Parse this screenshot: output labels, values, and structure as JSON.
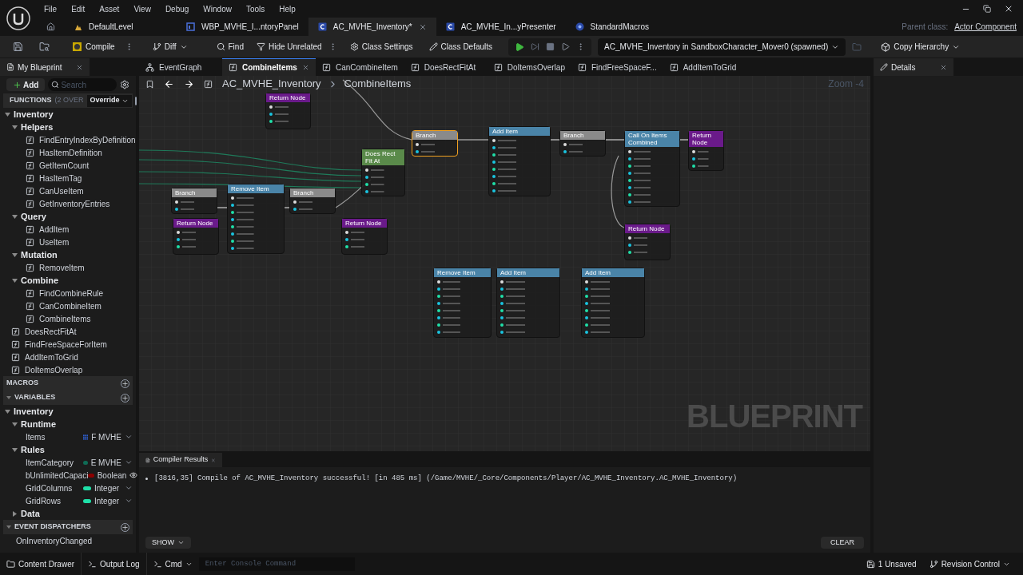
{
  "menu": [
    "File",
    "Edit",
    "Asset",
    "View",
    "Debug",
    "Window",
    "Tools",
    "Help"
  ],
  "asset_tabs": [
    {
      "label": "DefaultLevel",
      "kind": "level",
      "selected": false
    },
    {
      "label": "WBP_MVHE_I...ntoryPanel",
      "kind": "widget",
      "selected": false
    },
    {
      "label": "AC_MVHE_Inventory*",
      "kind": "blueprint",
      "selected": true
    },
    {
      "label": "AC_MVHE_In...yPresenter",
      "kind": "blueprint",
      "selected": false
    },
    {
      "label": "StandardMacros",
      "kind": "macro",
      "selected": false
    }
  ],
  "parent_class": {
    "label": "Parent class:",
    "value": "Actor Component"
  },
  "toolbar": {
    "compile": "Compile",
    "diff": "Diff",
    "find": "Find",
    "hide_unrelated": "Hide Unrelated",
    "class_settings": "Class Settings",
    "class_defaults": "Class Defaults",
    "debug_object": "AC_MVHE_Inventory in SandboxCharacter_Mover0 (spawned)",
    "copy_hierarchy": "Copy Hierarchy"
  },
  "my_blueprint": {
    "title": "My Blueprint",
    "add": "Add",
    "search": {
      "placeholder": "Search"
    },
    "functions": {
      "title": "FUNCTIONS",
      "note": "(2 OVER",
      "override": "Override",
      "items": [
        {
          "label": "Inventory",
          "kind": "category",
          "expanded": true,
          "children": [
            {
              "label": "Helpers",
              "kind": "category",
              "expanded": true,
              "children": [
                {
                  "label": "FindEntryIndexByDefinition",
                  "kind": "function"
                },
                {
                  "label": "HasItemDefinition",
                  "kind": "function"
                },
                {
                  "label": "GetItemCount",
                  "kind": "function"
                },
                {
                  "label": "HasItemTag",
                  "kind": "function"
                },
                {
                  "label": "CanUseItem",
                  "kind": "function"
                },
                {
                  "label": "GetInventoryEntries",
                  "kind": "function"
                }
              ]
            },
            {
              "label": "Query",
              "kind": "category",
              "expanded": true,
              "children": [
                {
                  "label": "AddItem",
                  "kind": "function"
                },
                {
                  "label": "UseItem",
                  "kind": "function"
                }
              ]
            },
            {
              "label": "Mutation",
              "kind": "category",
              "expanded": true,
              "children": [
                {
                  "label": "RemoveItem",
                  "kind": "function"
                }
              ]
            },
            {
              "label": "Combine",
              "kind": "category",
              "expanded": true,
              "children": [
                {
                  "label": "FindCombineRule",
                  "kind": "function"
                },
                {
                  "label": "CanCombineItem",
                  "kind": "function"
                },
                {
                  "label": "CombineItems",
                  "kind": "function"
                }
              ]
            }
          ]
        },
        {
          "label": "DoesRectFitAt",
          "kind": "function"
        },
        {
          "label": "FindFreeSpaceForItem",
          "kind": "function"
        },
        {
          "label": "AddItemToGrid",
          "kind": "function"
        },
        {
          "label": "DoItemsOverlap",
          "kind": "function"
        }
      ]
    },
    "macros": {
      "title": "MACROS"
    },
    "variables": {
      "title": "VARIABLES",
      "items": [
        {
          "label": "Inventory",
          "kind": "category",
          "expanded": true,
          "children": [
            {
              "label": "Runtime",
              "kind": "category",
              "expanded": true,
              "children": [
                {
                  "label": "Items",
                  "kind": "array-variable",
                  "type": "F MVHE",
                  "color": "#2f5fd0",
                  "instance_editable": false
                }
              ]
            },
            {
              "label": "Rules",
              "kind": "category",
              "expanded": true,
              "children": [
                {
                  "label": "ItemCategory",
                  "kind": "variable",
                  "type": "E MVHE",
                  "color": "#0f6b55",
                  "instance_editable": false
                },
                {
                  "label": "bUnlimitedCapaci",
                  "kind": "variable",
                  "type": "Boolean",
                  "color": "#8c0000",
                  "instance_editable": true
                },
                {
                  "label": "GridColumns",
                  "kind": "variable",
                  "type": "Integer",
                  "color": "#1fe0a8",
                  "instance_editable": false
                },
                {
                  "label": "GridRows",
                  "kind": "variable",
                  "type": "Integer",
                  "color": "#1fe0a8",
                  "instance_editable": false
                }
              ]
            },
            {
              "label": "Data",
              "kind": "category",
              "expanded": false
            }
          ]
        }
      ]
    },
    "event_dispatchers": {
      "title": "EVENT DISPATCHERS",
      "items": [
        "OnInventoryChanged"
      ]
    }
  },
  "graph_tabs": [
    {
      "label": "EventGraph",
      "kind": "graph",
      "selected": false
    },
    {
      "label": "CombineItems",
      "kind": "function",
      "selected": true
    },
    {
      "label": "CanCombineItem",
      "kind": "function",
      "selected": false
    },
    {
      "label": "DoesRectFitAt",
      "kind": "function",
      "selected": false
    },
    {
      "label": "DoItemsOverlap",
      "kind": "function",
      "selected": false
    },
    {
      "label": "FindFreeSpaceF...",
      "kind": "function",
      "selected": false
    },
    {
      "label": "AddItemToGrid",
      "kind": "function",
      "selected": false
    }
  ],
  "graph": {
    "breadcrumb": [
      "AC_MVHE_Inventory",
      "CombineItems"
    ],
    "zoom": "Zoom -4",
    "watermark": "BLUEPRINT",
    "nodes": [
      {
        "title": "Return Node",
        "kind": "return",
        "selected": false
      },
      {
        "title": "Branch",
        "kind": "branch",
        "selected": true
      },
      {
        "title": "Does Rect Fit At",
        "kind": "pure",
        "selected": false
      },
      {
        "title": "Add Item",
        "kind": "call",
        "selected": false
      },
      {
        "title": "Branch",
        "kind": "branch",
        "selected": false
      },
      {
        "title": "Call On Items Combined",
        "kind": "call",
        "selected": false
      },
      {
        "title": "Return Node",
        "kind": "return",
        "selected": false
      },
      {
        "title": "Branch",
        "kind": "branch",
        "selected": false
      },
      {
        "title": "Remove Item",
        "kind": "call",
        "selected": false
      },
      {
        "title": "Branch",
        "kind": "branch",
        "selected": false
      },
      {
        "title": "Return Node",
        "kind": "return",
        "selected": false
      },
      {
        "title": "Return Node",
        "kind": "return",
        "selected": false
      },
      {
        "title": "Return Node",
        "kind": "return",
        "selected": false
      },
      {
        "title": "Remove Item",
        "kind": "call",
        "selected": false
      },
      {
        "title": "Add Item",
        "kind": "call",
        "selected": false
      },
      {
        "title": "Add Item",
        "kind": "call",
        "selected": false
      }
    ]
  },
  "compiler_results": {
    "title": "Compiler Results",
    "messages": [
      "[3816,35] Compile of AC_MVHE_Inventory successful! [in 485 ms] (/Game/MVHE/_Core/Components/Player/AC_MVHE_Inventory.AC_MVHE_Inventory)"
    ],
    "show": "SHOW",
    "clear": "CLEAR"
  },
  "details": {
    "title": "Details"
  },
  "status_bar": {
    "content_drawer": "Content Drawer",
    "output_log": "Output Log",
    "cmd": "Cmd",
    "console": {
      "placeholder": "Enter Console Command"
    },
    "unsaved": "1 Unsaved",
    "revision_control": "Revision Control"
  }
}
